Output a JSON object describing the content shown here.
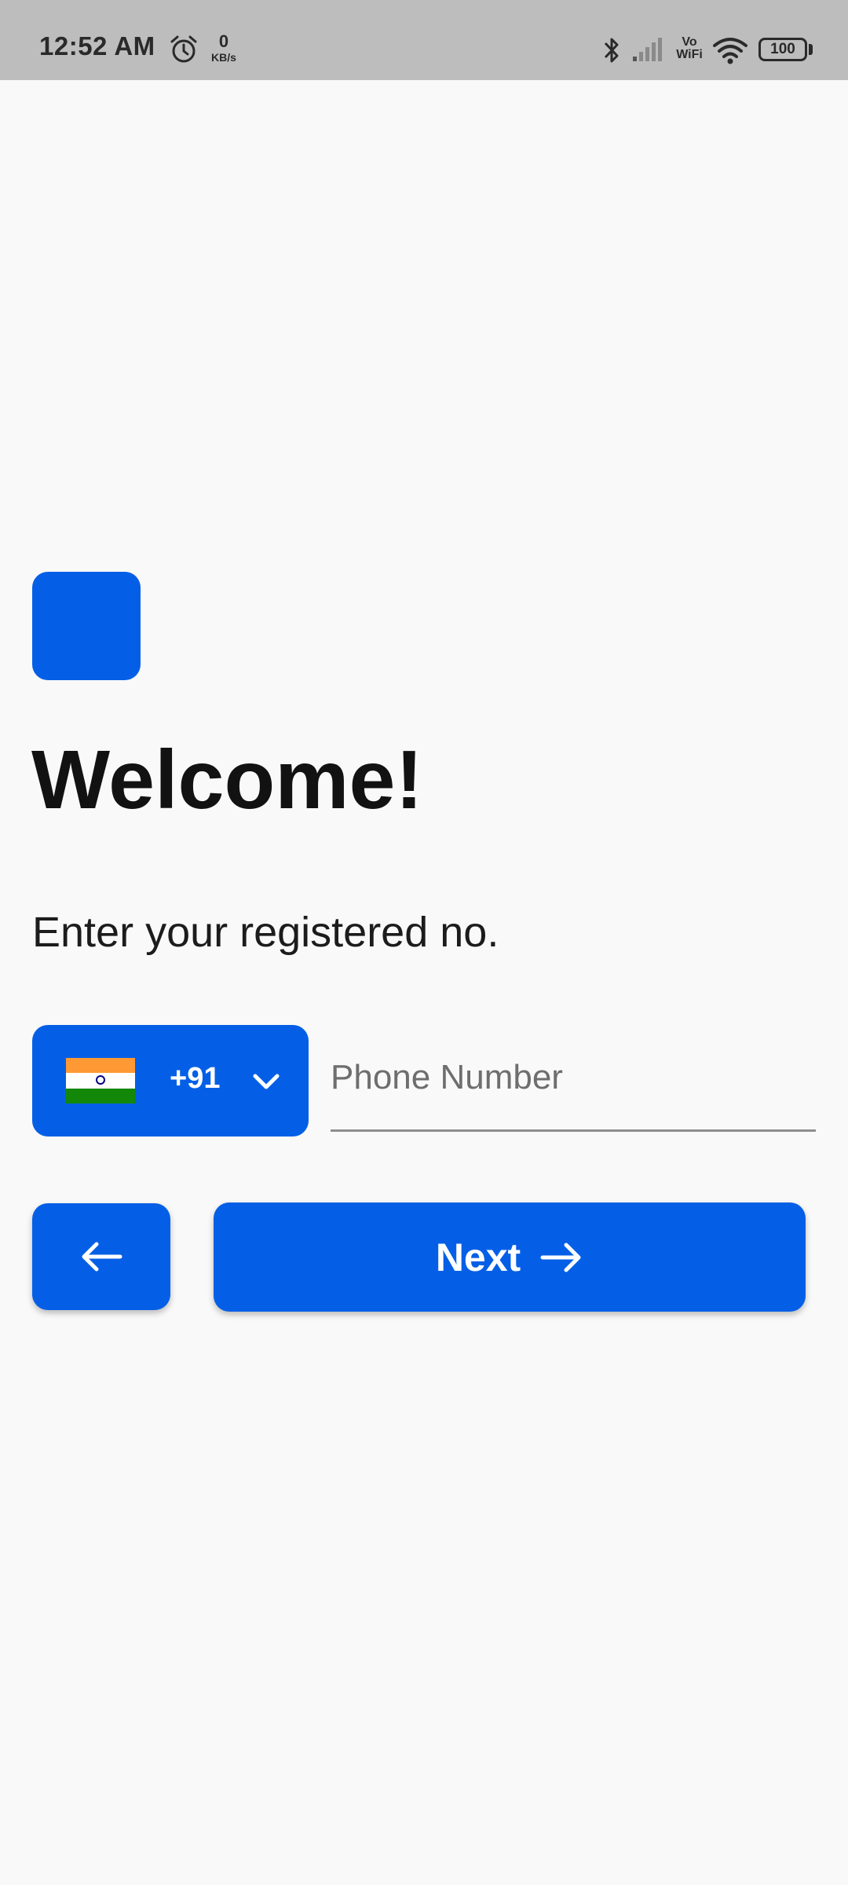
{
  "status_bar": {
    "time": "12:52 AM",
    "data_rate": "0",
    "data_rate_unit": "KB/s",
    "vowifi_top": "Vo",
    "vowifi_bottom": "WiFi",
    "battery_level": "100",
    "icons": [
      "alarm-icon",
      "bluetooth-icon",
      "signal-icon",
      "wifi-icon",
      "battery-icon"
    ]
  },
  "main": {
    "title": "Welcome!",
    "subtitle": "Enter your registered no.",
    "country_code": "+91",
    "country_flag": "india-flag-icon",
    "phone_placeholder": "Phone Number",
    "phone_value": "",
    "next_label": "Next"
  },
  "colors": {
    "accent": "#055fe6",
    "background": "#f9f9f9",
    "status_bar": "#bdbdbd",
    "title_text": "#121212"
  }
}
